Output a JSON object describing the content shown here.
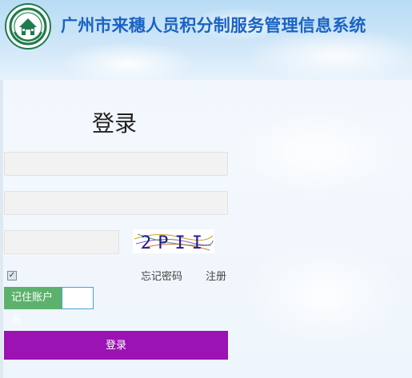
{
  "header": {
    "title": "广州市来穗人员积分制服务管理信息系统",
    "logo_icon": "government-emblem-icon"
  },
  "login": {
    "heading": "登录",
    "username_value": "",
    "password_value": "",
    "captcha_value": "",
    "captcha_text": "2PII",
    "remember_checked": true,
    "forgot_password_label": "忘记密码",
    "register_label": "注册",
    "remember_account_label": "记住账户名",
    "submit_label": "登录"
  },
  "colors": {
    "title": "#1b63c4",
    "remember_bg": "#5cb26c",
    "submit_bg": "#9b13b3"
  }
}
